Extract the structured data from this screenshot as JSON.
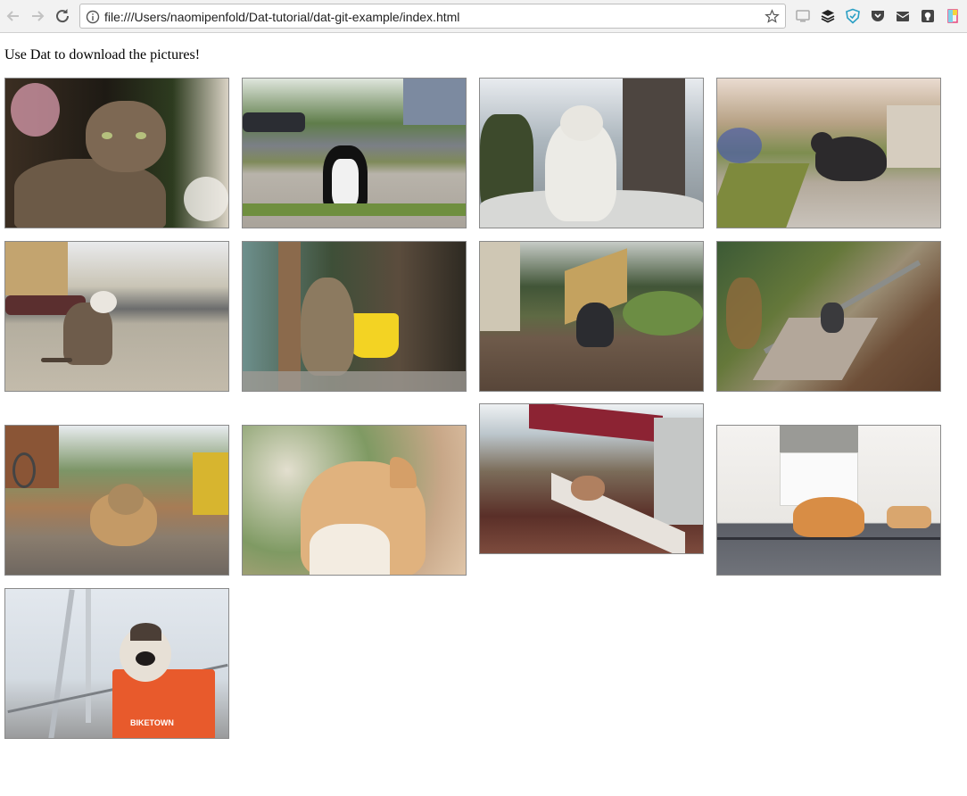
{
  "browser": {
    "url": "file:///Users/naomipenfold/Dat-tutorial/dat-git-example/index.html",
    "buttons": {
      "back": "arrow-left-icon",
      "forward": "arrow-right-icon",
      "reload": "reload-icon",
      "info": "info-icon",
      "bookmark": "star-icon"
    },
    "extensions": [
      "cast-icon",
      "layers-icon",
      "shield-icon",
      "pocket-icon",
      "mail-icon",
      "bulb-icon",
      "notebook-icon"
    ]
  },
  "page": {
    "heading": "Use Dat to download the pictures!",
    "photos": [
      {
        "subject": "tabby cat lying by a tree"
      },
      {
        "subject": "black and white cat on a sidewalk"
      },
      {
        "subject": "white cat sitting on a ledge"
      },
      {
        "subject": "fluffy dark grey cat on a path"
      },
      {
        "subject": "tabby cat sitting on a sidewalk"
      },
      {
        "subject": "long-haired tabby cat by a yellow bucket"
      },
      {
        "subject": "grey cat on a dirt yard"
      },
      {
        "subject": "cat on garden steps"
      },
      {
        "subject": "persian cat on leaves"
      },
      {
        "subject": "orange cat close-up"
      },
      {
        "subject": "cat on a gutter"
      },
      {
        "subject": "orange cat on a porch step"
      },
      {
        "subject": "cat in a BIKETOWN bike basket"
      }
    ],
    "basket_logo_text": "BIKETOWN"
  }
}
